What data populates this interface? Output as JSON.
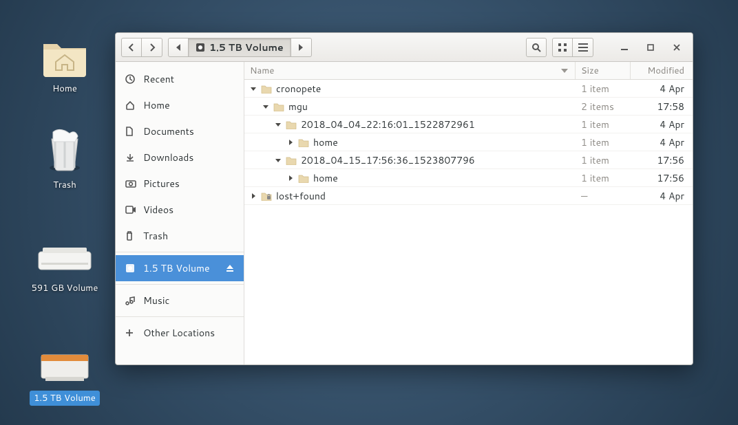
{
  "desktop": {
    "home": {
      "label": "Home"
    },
    "trash": {
      "label": "Trash"
    },
    "vol1": {
      "label": "591 GB Volume"
    },
    "vol2": {
      "label": "1.5 TB Volume"
    }
  },
  "window": {
    "path_label": "1.5 TB Volume",
    "sidebar": [
      {
        "icon": "clock",
        "label": "Recent"
      },
      {
        "icon": "home",
        "label": "Home"
      },
      {
        "icon": "doc",
        "label": "Documents"
      },
      {
        "icon": "down",
        "label": "Downloads"
      },
      {
        "icon": "camera",
        "label": "Pictures"
      },
      {
        "icon": "video",
        "label": "Videos"
      },
      {
        "icon": "trash",
        "label": "Trash"
      },
      {
        "icon": "disk",
        "label": "1.5 TB Volume",
        "selected": true,
        "eject": true
      },
      {
        "icon": "music",
        "label": "Music"
      },
      {
        "icon": "plus",
        "label": "Other Locations"
      }
    ],
    "columns": {
      "name": "Name",
      "size": "Size",
      "modified": "Modified"
    },
    "rows": [
      {
        "indent": 0,
        "expanded": true,
        "icon": "folder",
        "name": "cronopete",
        "size": "1 item",
        "modified": "4 Apr"
      },
      {
        "indent": 1,
        "expanded": true,
        "icon": "folder",
        "name": "mgu",
        "size": "2 items",
        "modified": "17:58"
      },
      {
        "indent": 2,
        "expanded": true,
        "icon": "folder",
        "name": "2018_04_04_22:16:01_1522872961",
        "size": "1 item",
        "modified": "4 Apr"
      },
      {
        "indent": 3,
        "expanded": false,
        "icon": "folder",
        "name": "home",
        "size": "1 item",
        "modified": "4 Apr"
      },
      {
        "indent": 2,
        "expanded": true,
        "icon": "folder",
        "name": "2018_04_15_17:56:36_1523807796",
        "size": "1 item",
        "modified": "17:56"
      },
      {
        "indent": 3,
        "expanded": false,
        "icon": "folder",
        "name": "home",
        "size": "1 item",
        "modified": "17:56"
      },
      {
        "indent": 0,
        "expanded": false,
        "icon": "folder-lock",
        "name": "lost+found",
        "size": "—",
        "modified": "4 Apr"
      }
    ]
  }
}
